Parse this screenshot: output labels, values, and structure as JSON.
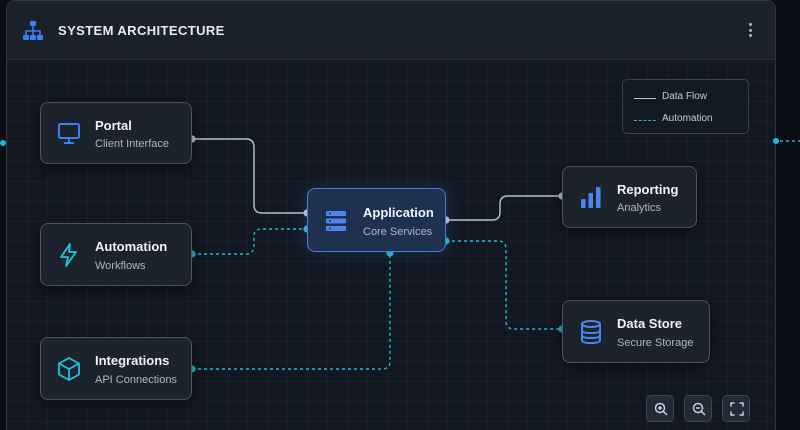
{
  "header": {
    "title": "SYSTEM ARCHITECTURE",
    "icon": "sitemap-icon",
    "menu_icon": "more-vertical-icon"
  },
  "colors": {
    "accent": "#3c7ff0",
    "data_flow": "#b8c2d0",
    "automation": "#22b8d4",
    "core_border": "#4b7bd6"
  },
  "nodes": {
    "portal": {
      "title": "Portal",
      "subtitle": "Client Interface",
      "icon": "monitor-icon"
    },
    "automation": {
      "title": "Automation",
      "subtitle": "Workflows",
      "icon": "lightning-icon"
    },
    "integrations": {
      "title": "Integrations",
      "subtitle": "API Connections",
      "icon": "cube-icon"
    },
    "application": {
      "title": "Application",
      "subtitle": "Core Services",
      "icon": "server-icon"
    },
    "reporting": {
      "title": "Reporting",
      "subtitle": "Analytics",
      "icon": "bar-chart-icon"
    },
    "datastore": {
      "title": "Data Store",
      "subtitle": "Secure Storage",
      "icon": "database-icon"
    }
  },
  "edges": [
    {
      "from": "portal",
      "to": "application",
      "type": "data-flow"
    },
    {
      "from": "automation",
      "to": "application",
      "type": "automation"
    },
    {
      "from": "integrations",
      "to": "application",
      "type": "automation"
    },
    {
      "from": "application",
      "to": "reporting",
      "type": "data-flow"
    },
    {
      "from": "application",
      "to": "datastore",
      "type": "automation"
    }
  ],
  "legend": {
    "data_flow": "Data Flow",
    "automation": "Automation"
  },
  "toolbar": {
    "zoom_in_icon": "zoom-in-icon",
    "zoom_out_icon": "zoom-out-icon",
    "fit_icon": "fit-screen-icon"
  }
}
